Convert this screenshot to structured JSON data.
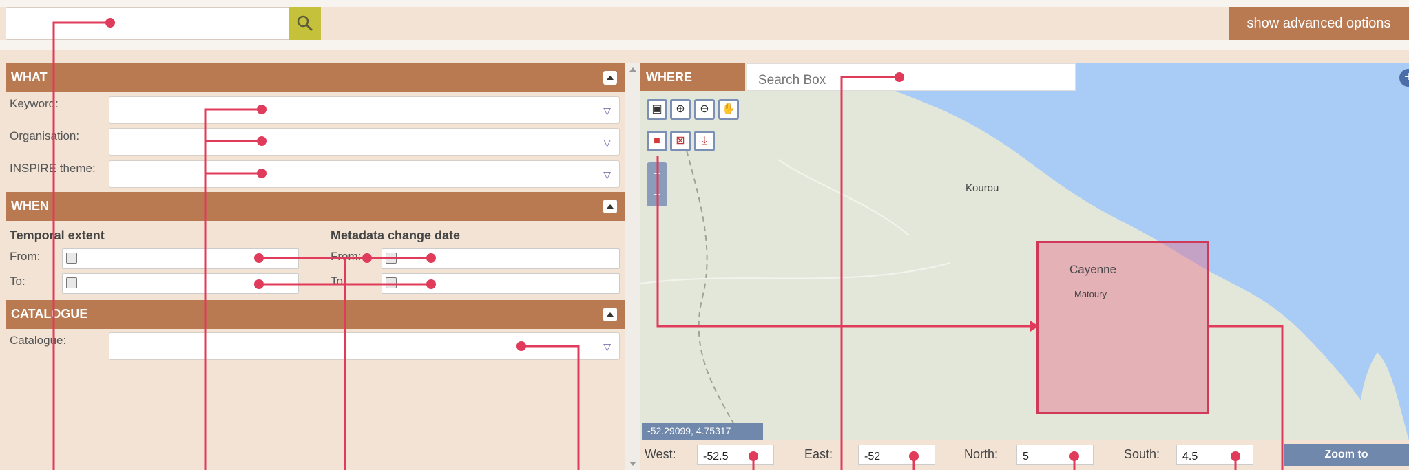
{
  "toolbar": {
    "search_placeholder": "",
    "advanced_label": "show advanced options"
  },
  "what": {
    "title": "WHAT",
    "keyword_label": "Keyword:",
    "organisation_label": "Organisation:",
    "inspire_label": "INSPIRE theme:"
  },
  "when": {
    "title": "WHEN",
    "temporal_title": "Temporal extent",
    "metadata_title": "Metadata change date",
    "from_label": "From:",
    "to_label": "To:"
  },
  "catalogue": {
    "title": "CATALOGUE",
    "label": "Catalogue:"
  },
  "where": {
    "title": "WHERE",
    "search_placeholder": "Search Box",
    "coord_readout": "-52.29099, 4.75317",
    "cities": [
      "Kourou",
      "Cayenne",
      "Matoury"
    ],
    "west_label": "West:",
    "east_label": "East:",
    "north_label": "North:",
    "south_label": "South:",
    "west": "-52.5",
    "east": "-52",
    "north": "5",
    "south": "4.5",
    "zoom_to": "Zoom to"
  },
  "colors": {
    "header": "#b97a52",
    "panel": "#f2e3d4",
    "search_button": "#c6c13a",
    "map_ocean": "#a9ccf6",
    "map_land": "#e3e7da",
    "bbox_fill": "#e38ba3",
    "annotation": "#e03b5a",
    "tool_border": "#7b90b4"
  },
  "icons": [
    "search-icon",
    "collapse-icon",
    "dropdown-caret-icon",
    "calendar-icon",
    "zoom-box-icon",
    "zoom-in-icon",
    "zoom-out-icon",
    "pan-icon",
    "draw-bbox-icon",
    "clear-bbox-icon",
    "download-icon",
    "plus-icon"
  ]
}
